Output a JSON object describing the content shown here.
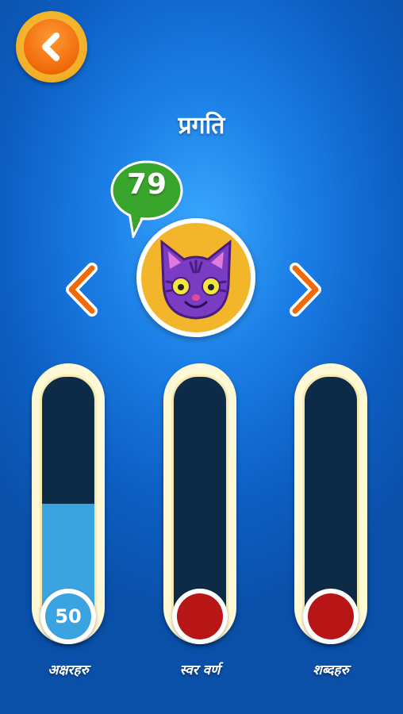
{
  "header": {
    "title": "प्रगति"
  },
  "back_button": {
    "icon": "chevron-left-icon"
  },
  "character": {
    "score": "79",
    "avatar": "purple-cat-icon",
    "prev_icon": "chevron-left-icon",
    "next_icon": "chevron-right-icon"
  },
  "progress": [
    {
      "label": "अक्षरहरु",
      "value": "50",
      "fill_percent": 50,
      "badge_color": "#3ba3e0"
    },
    {
      "label": "स्वर वर्ण",
      "value": "",
      "fill_percent": 0,
      "badge_color": "#b81616"
    },
    {
      "label": "शब्दहरु",
      "value": "",
      "fill_percent": 0,
      "badge_color": "#b81616"
    }
  ],
  "colors": {
    "background": "#1b7fe6",
    "accent_orange": "#f06a0a",
    "score_bubble": "#3aa52d",
    "bar_track": "#0d2b47",
    "bar_fill": "#3ba3e0"
  }
}
